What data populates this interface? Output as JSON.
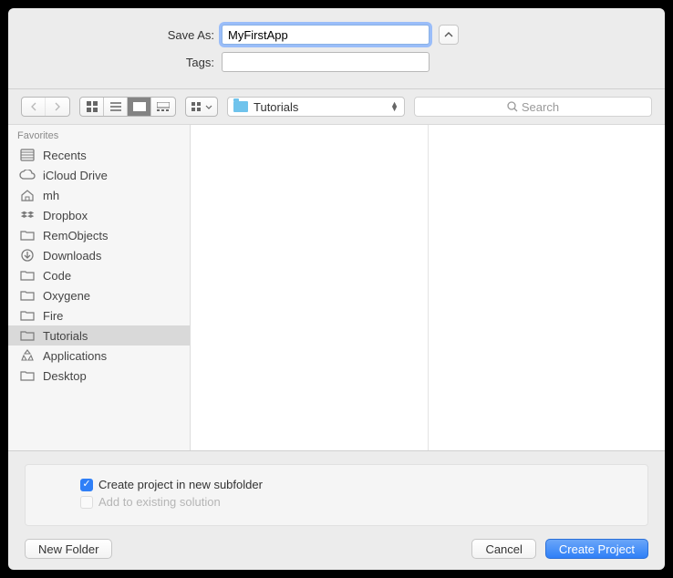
{
  "saveAs": {
    "label": "Save As:",
    "value": "MyFirstApp"
  },
  "tags": {
    "label": "Tags:",
    "value": ""
  },
  "location": {
    "current": "Tutorials"
  },
  "search": {
    "placeholder": "Search"
  },
  "sidebar": {
    "header": "Favorites",
    "items": [
      {
        "label": "Recents",
        "icon": "recents"
      },
      {
        "label": "iCloud Drive",
        "icon": "cloud"
      },
      {
        "label": "mh",
        "icon": "home"
      },
      {
        "label": "Dropbox",
        "icon": "dropbox"
      },
      {
        "label": "RemObjects",
        "icon": "folder"
      },
      {
        "label": "Downloads",
        "icon": "download"
      },
      {
        "label": "Code",
        "icon": "folder"
      },
      {
        "label": "Oxygene",
        "icon": "folder"
      },
      {
        "label": "Fire",
        "icon": "folder"
      },
      {
        "label": "Tutorials",
        "icon": "folder",
        "selected": true
      },
      {
        "label": "Applications",
        "icon": "app"
      },
      {
        "label": "Desktop",
        "icon": "folder"
      }
    ]
  },
  "options": {
    "subfolder": {
      "label": "Create project in new subfolder",
      "checked": true
    },
    "existing": {
      "label": "Add to existing solution",
      "checked": false,
      "disabled": true
    }
  },
  "buttons": {
    "newFolder": "New Folder",
    "cancel": "Cancel",
    "create": "Create Project"
  }
}
